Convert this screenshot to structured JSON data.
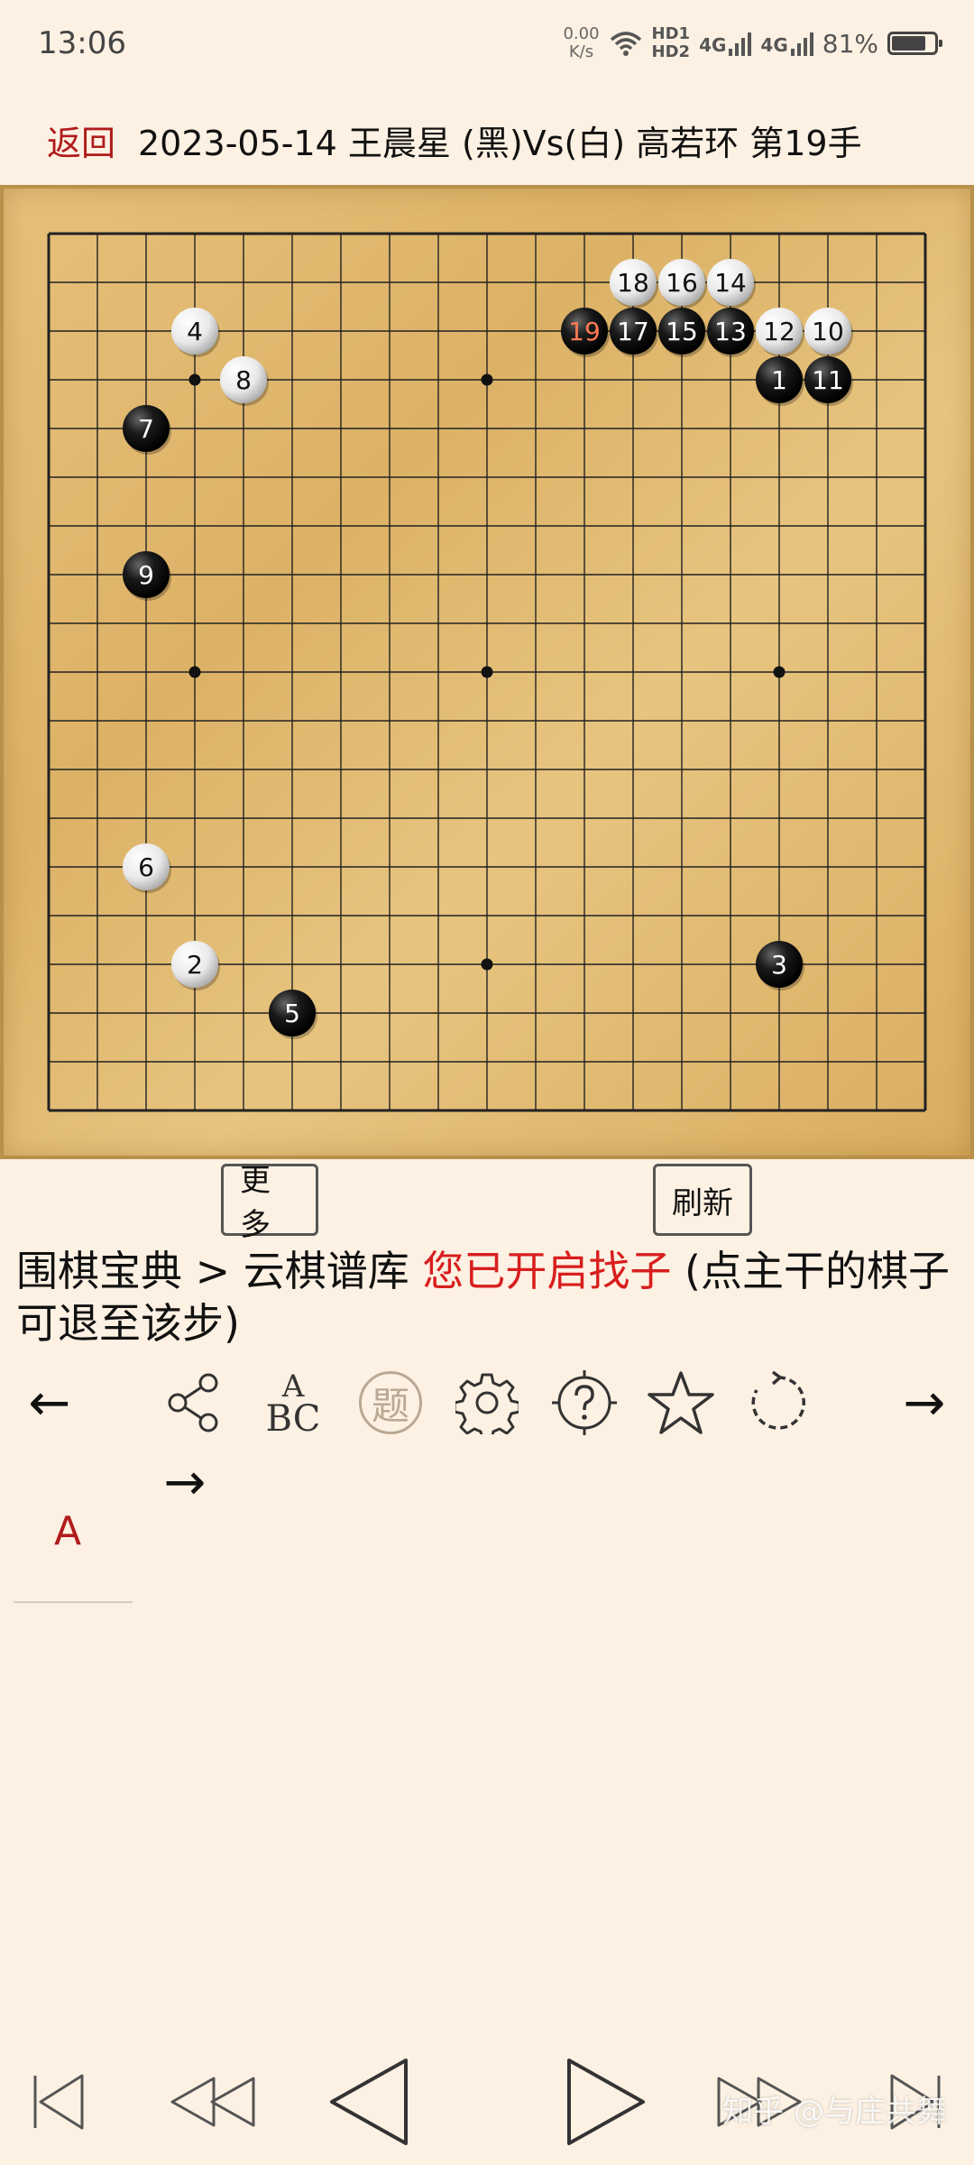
{
  "status_bar": {
    "time": "13:06",
    "net_speed_value": "0.00",
    "net_speed_unit": "K/s",
    "hd1": "HD1",
    "hd2": "HD2",
    "sig1": "4G",
    "sig2": "4G",
    "battery_pct": "81%",
    "battery_level": 0.81
  },
  "header": {
    "back_label": "返回",
    "title": "2023-05-14 王晨星 (黑)Vs(白) 高若环 第19手"
  },
  "board": {
    "size": 19,
    "star_points": [
      [
        3,
        3
      ],
      [
        9,
        3
      ],
      [
        15,
        3
      ],
      [
        3,
        9
      ],
      [
        9,
        9
      ],
      [
        15,
        9
      ],
      [
        3,
        15
      ],
      [
        9,
        15
      ],
      [
        15,
        15
      ]
    ],
    "stones": [
      {
        "n": "1",
        "color": "black",
        "col": 15,
        "row": 3
      },
      {
        "n": "2",
        "color": "white",
        "col": 3,
        "row": 15
      },
      {
        "n": "3",
        "color": "black",
        "col": 15,
        "row": 15
      },
      {
        "n": "4",
        "color": "white",
        "col": 3,
        "row": 2
      },
      {
        "n": "5",
        "color": "black",
        "col": 5,
        "row": 16
      },
      {
        "n": "6",
        "color": "white",
        "col": 2,
        "row": 13
      },
      {
        "n": "7",
        "color": "black",
        "col": 2,
        "row": 4
      },
      {
        "n": "8",
        "color": "white",
        "col": 4,
        "row": 3
      },
      {
        "n": "9",
        "color": "black",
        "col": 2,
        "row": 7
      },
      {
        "n": "10",
        "color": "white",
        "col": 16,
        "row": 2
      },
      {
        "n": "11",
        "color": "black",
        "col": 16,
        "row": 3
      },
      {
        "n": "12",
        "color": "white",
        "col": 15,
        "row": 2
      },
      {
        "n": "13",
        "color": "black",
        "col": 14,
        "row": 2
      },
      {
        "n": "14",
        "color": "white",
        "col": 14,
        "row": 1
      },
      {
        "n": "15",
        "color": "black",
        "col": 13,
        "row": 2
      },
      {
        "n": "16",
        "color": "white",
        "col": 13,
        "row": 1
      },
      {
        "n": "17",
        "color": "black",
        "col": 12,
        "row": 2
      },
      {
        "n": "18",
        "color": "white",
        "col": 12,
        "row": 1
      },
      {
        "n": "19",
        "color": "black",
        "col": 11,
        "row": 2,
        "last": true
      }
    ],
    "colors": {
      "grid": "#222222",
      "black_stone": "#111111",
      "white_stone": "#f2f2f2",
      "last_move_number": "#ff7a55"
    }
  },
  "buttons": {
    "more": "更多",
    "refresh": "刷新"
  },
  "info": {
    "path": "围棋宝典 > 云棋谱库 ",
    "highlight": "您已开启找子",
    "hint": " (点主干的棋子可退至该步)"
  },
  "toolbar": {
    "prev_arrow": "←",
    "next_arrow": "→",
    "next_arrow_2": "→",
    "abc_top": "A",
    "abc_bottom": "BC",
    "problem_char": "题",
    "icons": [
      "share-icon",
      "abc-icon",
      "problem-icon",
      "gear-icon",
      "help-icon",
      "star-icon",
      "rotate-icon"
    ]
  },
  "extra": {
    "letter": "A"
  },
  "bottom_nav": {
    "icons": [
      "first-move-icon",
      "rewind-icon",
      "prev-move-icon",
      "next-move-icon",
      "fast-forward-icon",
      "last-move-icon"
    ]
  },
  "watermark": "知乎 @与庄共舞"
}
